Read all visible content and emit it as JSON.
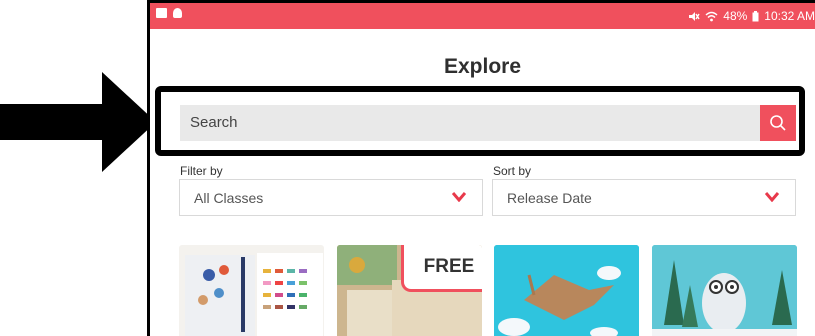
{
  "status_bar": {
    "battery": "48%",
    "time": "10:32 AM"
  },
  "page": {
    "title": "Explore"
  },
  "search": {
    "placeholder": "Search"
  },
  "filters": {
    "filter_label": "Filter by",
    "filter_value": "All Classes",
    "sort_label": "Sort by",
    "sort_value": "Release Date"
  },
  "cards": [
    {
      "badge": ""
    },
    {
      "badge": "FREE"
    },
    {
      "badge": ""
    },
    {
      "badge": ""
    }
  ],
  "colors": {
    "accent": "#f0505d",
    "annotation": "#000000"
  }
}
